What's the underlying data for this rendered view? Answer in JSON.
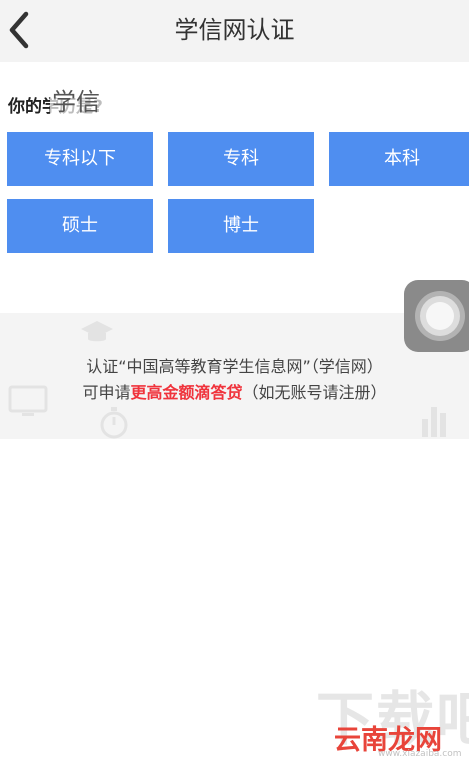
{
  "header": {
    "title": "学信网认证"
  },
  "question": {
    "text": "你的学历是?",
    "overlay_text": "学信"
  },
  "options": [
    {
      "label": "专科以下"
    },
    {
      "label": "专科"
    },
    {
      "label": "本科"
    },
    {
      "label": "硕士"
    },
    {
      "label": "博士"
    }
  ],
  "info": {
    "line1": "认证“中国高等教育学生信息网”（学信网）",
    "line2_prefix": "可申请",
    "line2_highlight": "更高金额滴答贷",
    "line2_suffix": "（如无账号请注册）"
  },
  "watermark": {
    "big": "下载吧",
    "brand": "云南龙网",
    "url": "www.xiazaiba.com"
  },
  "colors": {
    "accent": "#4f8ef0",
    "highlight": "#f0333c",
    "header_bg": "#f3f3f3",
    "band_bg": "#f4f4f4"
  }
}
